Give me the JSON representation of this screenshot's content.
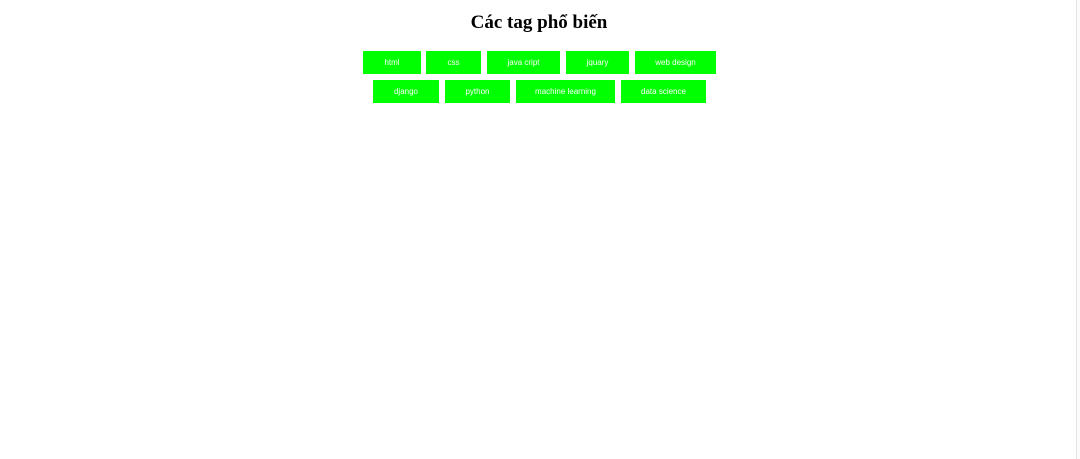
{
  "page": {
    "title": "Các tag phổ biến"
  },
  "tags": [
    {
      "label": "html"
    },
    {
      "label": "css"
    },
    {
      "label": "java cript"
    },
    {
      "label": "jquary"
    },
    {
      "label": "web design"
    },
    {
      "label": "django"
    },
    {
      "label": "python"
    },
    {
      "label": "machine learning"
    },
    {
      "label": "data science"
    }
  ],
  "colors": {
    "tag_background": "#00ff00",
    "tag_text": "#ffffff",
    "title_text": "#000000",
    "page_background": "#ffffff"
  }
}
